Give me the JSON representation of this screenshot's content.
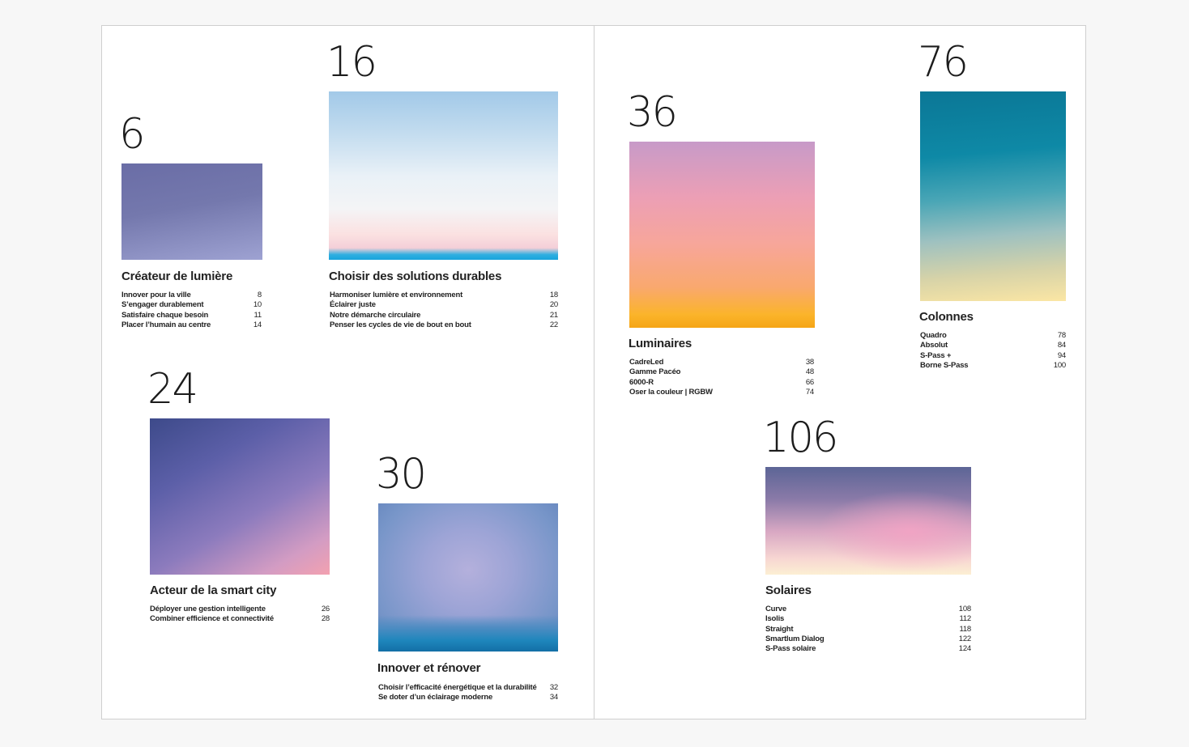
{
  "sections": {
    "s6": {
      "number": "6",
      "title": "Créateur de lumière",
      "image": "twilight-violet-sky",
      "items": [
        {
          "label": "Innover pour la ville",
          "page": "8"
        },
        {
          "label": "S’engager durablement",
          "page": "10"
        },
        {
          "label": "Satisfaire chaque besoin",
          "page": "11"
        },
        {
          "label": "Placer l’humain au centre",
          "page": "14"
        }
      ]
    },
    "s16": {
      "number": "16",
      "title": "Choisir des solutions durables",
      "image": "pale-blue-sky-horizon",
      "items": [
        {
          "label": "Harmoniser lumière et environnement",
          "page": "18"
        },
        {
          "label": "Éclairer juste",
          "page": "20"
        },
        {
          "label": "Notre démarche circulaire",
          "page": "21"
        },
        {
          "label": "Penser les cycles de vie de bout en bout",
          "page": "22"
        }
      ]
    },
    "s24": {
      "number": "24",
      "title": "Acteur de la smart city",
      "image": "indigo-pink-sky",
      "items": [
        {
          "label": "Déployer une gestion intelligente",
          "page": "26"
        },
        {
          "label": "Combiner efficience et connectivité",
          "page": "28"
        }
      ]
    },
    "s30": {
      "number": "30",
      "title": "Innover et rénover",
      "image": "blue-lavender-sea",
      "items": [
        {
          "label": "Choisir l’efficacité énergétique et la durabilité",
          "page": "32"
        },
        {
          "label": "Se doter d’un éclairage moderne",
          "page": "34"
        }
      ]
    },
    "s36": {
      "number": "36",
      "title": "Luminaires",
      "image": "pink-orange-sunset",
      "items": [
        {
          "label": "CadreLed",
          "page": "38"
        },
        {
          "label": "Gamme Pacéo",
          "page": "48"
        },
        {
          "label": "6000-R",
          "page": "66"
        },
        {
          "label": "Oser la couleur | RGBW",
          "page": "74"
        }
      ]
    },
    "s76": {
      "number": "76",
      "title": "Colonnes",
      "image": "teal-golden-sky",
      "items": [
        {
          "label": "Quadro",
          "page": "78"
        },
        {
          "label": "Absolut",
          "page": "84"
        },
        {
          "label": "S-Pass +",
          "page": "94"
        },
        {
          "label": "Borne S-Pass",
          "page": "100"
        }
      ]
    },
    "s106": {
      "number": "106",
      "title": "Solaires",
      "image": "dusk-clouds",
      "items": [
        {
          "label": "Curve",
          "page": "108"
        },
        {
          "label": "Isolis",
          "page": "112"
        },
        {
          "label": "Straight",
          "page": "118"
        },
        {
          "label": "Smartlum Dialog",
          "page": "122"
        },
        {
          "label": "S-Pass solaire",
          "page": "124"
        }
      ]
    }
  }
}
